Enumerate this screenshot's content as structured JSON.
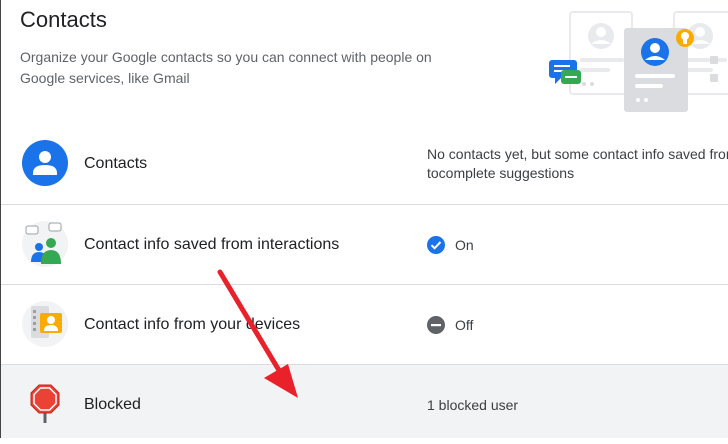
{
  "header": {
    "title": "Contacts",
    "description": "Organize your Google contacts so you can connect with people on Google services, like Gmail"
  },
  "rows": [
    {
      "label": "Contacts",
      "value_line1": "No contacts yet, but some contact info saved from",
      "value_line2": "tocomplete suggestions",
      "icon": "person-icon"
    },
    {
      "label": "Contact info saved from interactions",
      "value": "On",
      "status_icon": "checkmark-circle-icon",
      "icon": "people-chat-icon"
    },
    {
      "label": "Contact info from your devices",
      "value": "Off",
      "status_icon": "minus-circle-icon",
      "icon": "device-contact-icon"
    },
    {
      "label": "Blocked",
      "value": "1 blocked user",
      "icon": "stop-sign-icon"
    }
  ],
  "colors": {
    "accent_blue": "#1a73e8",
    "alert_red": "#e8212b",
    "row_highlight": "#f1f3f4"
  }
}
